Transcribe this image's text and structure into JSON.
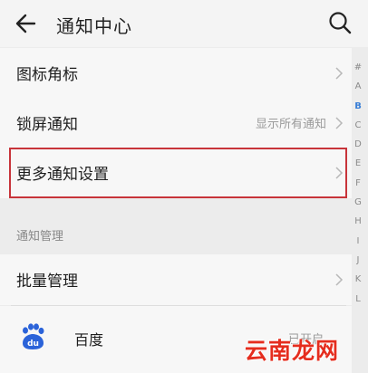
{
  "header": {
    "title": "通知中心",
    "back_icon": "arrow-left-icon",
    "search_icon": "search-icon"
  },
  "settings": [
    {
      "label": "图标角标",
      "value": ""
    },
    {
      "label": "锁屏通知",
      "value": "显示所有通知"
    },
    {
      "label": "更多通知设置",
      "value": ""
    }
  ],
  "section_title": "通知管理",
  "batch_manage": {
    "label": "批量管理"
  },
  "apps": [
    {
      "name": "百度",
      "status": "已开启",
      "icon": "baidu-paw-icon"
    }
  ],
  "index_letters": [
    "#",
    "A",
    "B",
    "C",
    "D",
    "E",
    "F",
    "G",
    "H",
    "I",
    "J",
    "K",
    "L"
  ],
  "active_index": "B",
  "watermark": "云南龙网",
  "colors": {
    "highlight_border": "#c8343a",
    "index_active": "#3a7fd6",
    "baidu_blue": "#2b63d9",
    "watermark": "#e52d1e"
  }
}
